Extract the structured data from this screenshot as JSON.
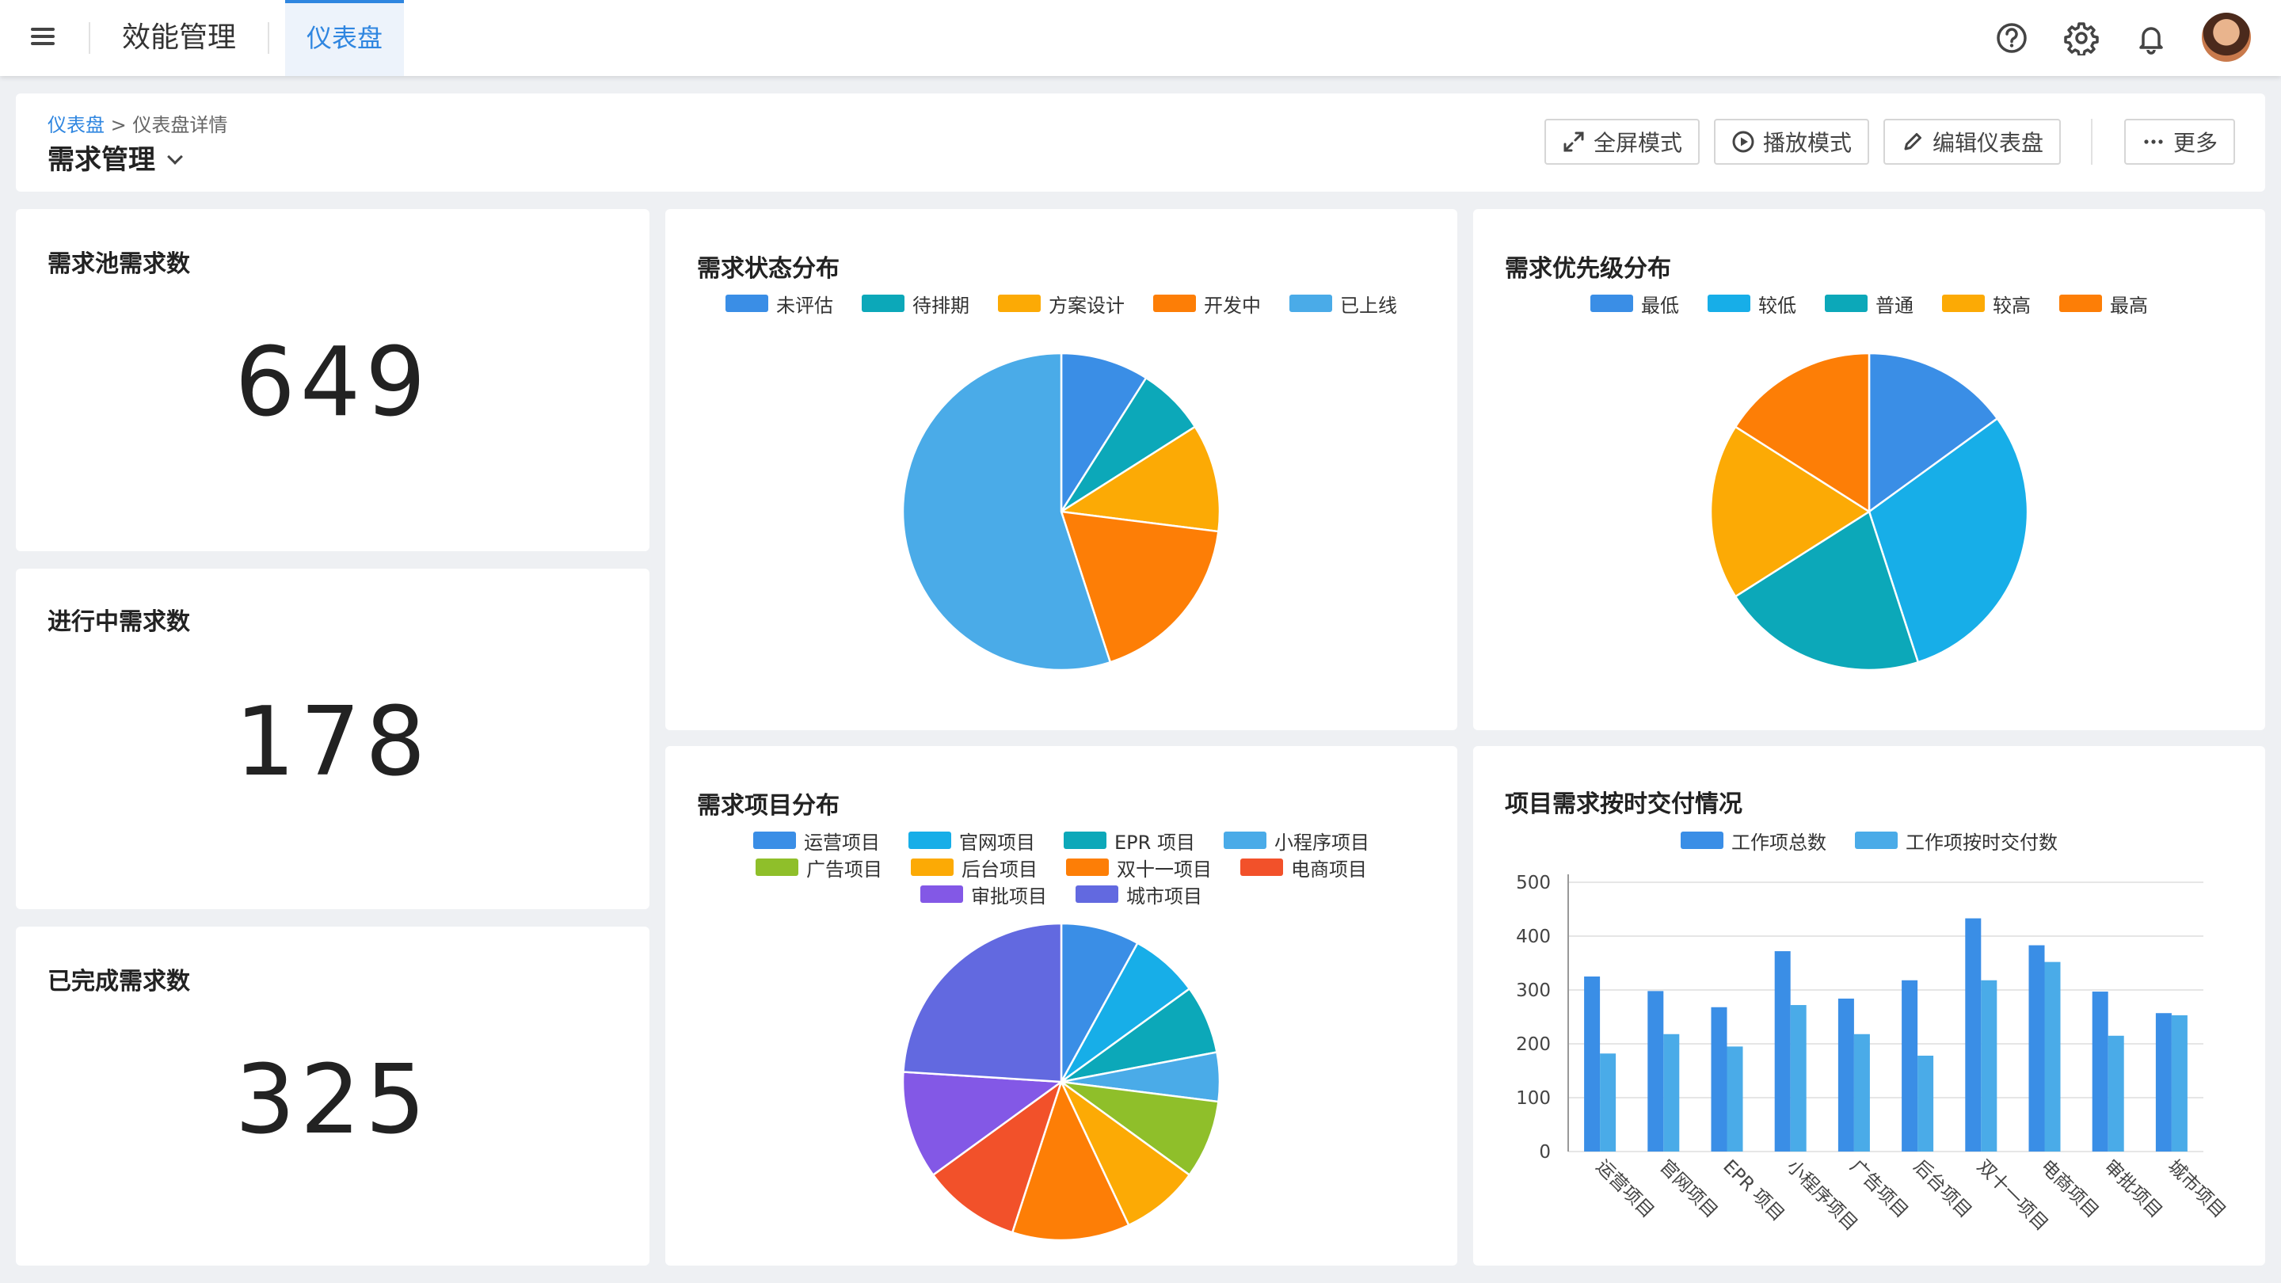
{
  "topbar": {
    "app_title": "效能管理",
    "active_tab": "仪表盘"
  },
  "header": {
    "breadcrumb_link": "仪表盘",
    "breadcrumb_sep": ">",
    "breadcrumb_current": "仪表盘详情",
    "title": "需求管理",
    "buttons": {
      "fullscreen": "全屏模式",
      "play": "播放模式",
      "edit": "编辑仪表盘",
      "more": "更多"
    }
  },
  "stats": [
    {
      "title": "需求池需求数",
      "value": "649"
    },
    {
      "title": "进行中需求数",
      "value": "178"
    },
    {
      "title": "已完成需求数",
      "value": "325"
    }
  ],
  "colors": {
    "accent": "#2f86e0",
    "blue": "#3a8ee6",
    "cyan": "#17aee8",
    "teal": "#0ca8b9",
    "amber": "#fcaa05",
    "orange": "#fd7e06",
    "lightblue": "#4aabe8",
    "green": "#8fbf2a",
    "red": "#f2512a",
    "purple": "#8358e6",
    "indigo": "#6269e0"
  },
  "chart_data": [
    {
      "type": "pie",
      "title": "需求状态分布",
      "labels": [
        "未评估",
        "待排期",
        "方案设计",
        "开发中",
        "已上线"
      ],
      "values": [
        9,
        7,
        11,
        18,
        55
      ],
      "colors": [
        "#3a8ee6",
        "#0ca8b9",
        "#fcaa05",
        "#fd7e06",
        "#4aabe8"
      ],
      "legend": "top"
    },
    {
      "type": "pie",
      "title": "需求优先级分布",
      "labels": [
        "最低",
        "较低",
        "普通",
        "较高",
        "最高"
      ],
      "values": [
        15,
        30,
        21,
        18,
        16
      ],
      "colors": [
        "#3a8ee6",
        "#17aee8",
        "#0ca8b9",
        "#fcaa05",
        "#fd7e06"
      ],
      "legend": "top"
    },
    {
      "type": "pie",
      "title": "需求项目分布",
      "labels": [
        "运营项目",
        "官网项目",
        "EPR 项目",
        "小程序项目",
        "广告项目",
        "后台项目",
        "双十一项目",
        "电商项目",
        "审批项目",
        "城市项目"
      ],
      "values": [
        8,
        7,
        7,
        5,
        8,
        8,
        12,
        10,
        11,
        24
      ],
      "colors": [
        "#3a8ee6",
        "#17aee8",
        "#0ca8b9",
        "#4aabe8",
        "#8fbf2a",
        "#fcaa05",
        "#fd7e06",
        "#f2512a",
        "#8358e6",
        "#6269e0"
      ],
      "legend": "top"
    },
    {
      "type": "bar",
      "title": "项目需求按时交付情况",
      "categories": [
        "运营项目",
        "官网项目",
        "EPR 项目",
        "小程序项目",
        "广告项目",
        "后台项目",
        "双十一项目",
        "电商项目",
        "审批项目",
        "城市项目"
      ],
      "series": [
        {
          "name": "工作项总数",
          "values": [
            325,
            298,
            268,
            372,
            284,
            318,
            433,
            383,
            297,
            257
          ],
          "color": "#3a8ee6"
        },
        {
          "name": "工作项按时交付数",
          "values": [
            182,
            218,
            195,
            272,
            218,
            178,
            318,
            352,
            215,
            253
          ],
          "color": "#4aabe8"
        }
      ],
      "ylim": [
        0,
        500
      ],
      "yticks": [
        0,
        100,
        200,
        300,
        400,
        500
      ],
      "grid": true,
      "legend": "top"
    }
  ]
}
